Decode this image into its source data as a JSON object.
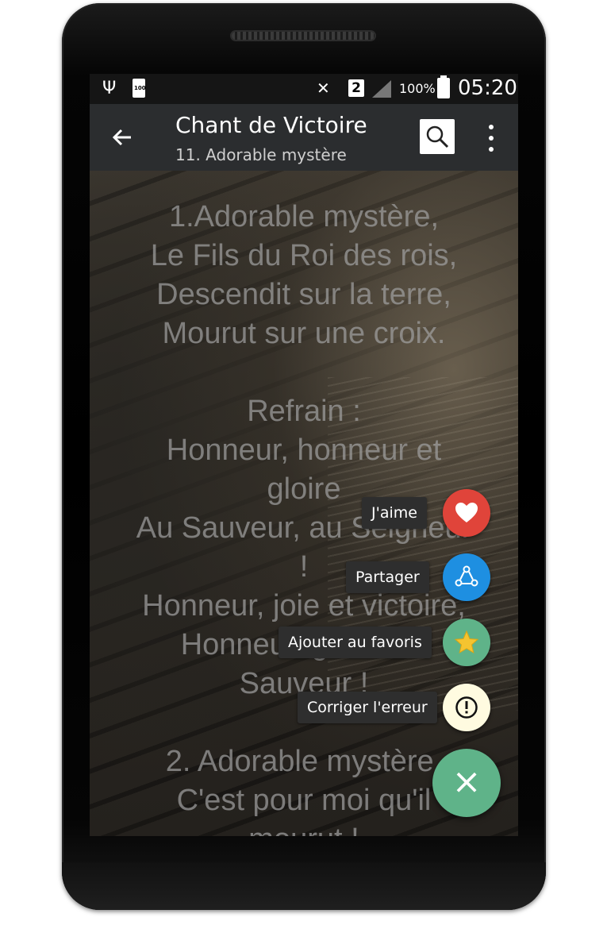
{
  "status_bar": {
    "battery_small_label": "100",
    "sim_slot": "2",
    "battery_percent": "100%",
    "time": "05:20"
  },
  "app_bar": {
    "back_icon": "arrow-back-icon",
    "title": "Chant de Victoire",
    "subtitle": "11. Adorable mystère",
    "search_icon": "search-icon",
    "menu_icon": "more-vert-icon"
  },
  "lyrics": {
    "lines": [
      "1.Adorable mystère,",
      "Le Fils du Roi des rois,",
      "Descendit sur la terre,",
      "Mourut sur une croix.",
      "",
      "Refrain :",
      "Honneur, honneur et",
      "gloire",
      "Au Sauveur, au Seigneur",
      "!",
      "Honneur, joie et victoire,",
      "Honneur, gloire au",
      "Sauveur !",
      "",
      "2. Adorable mystère,",
      "C'est pour moi qu'il",
      "mourut !"
    ]
  },
  "fab_menu": {
    "items": [
      {
        "label": "J'aime",
        "icon": "heart-icon",
        "color": "#e0443a"
      },
      {
        "label": "Partager",
        "icon": "share-icon",
        "color": "#1e8fe1"
      },
      {
        "label": "Ajouter au favoris",
        "icon": "star-icon",
        "color": "#5fb389"
      },
      {
        "label": "Corriger l'erreur",
        "icon": "exclamation-circle-icon",
        "color": "#fffbe0"
      }
    ],
    "main_button_symbol": "×",
    "main_button_color": "#5fb389"
  }
}
